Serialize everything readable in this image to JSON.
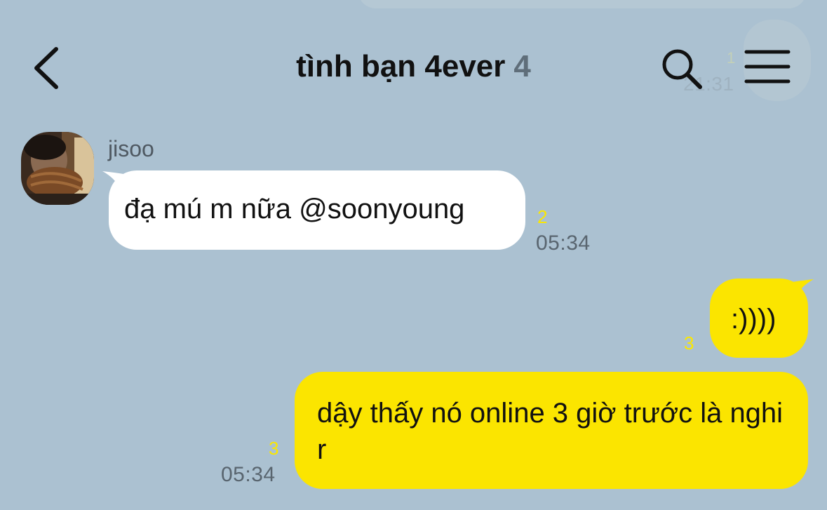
{
  "header": {
    "title": "tình bạn 4ever",
    "member_count": "4",
    "back_icon": "chevron-left-icon",
    "search_icon": "search-icon",
    "menu_icon": "hamburger-menu-icon"
  },
  "background_ghost": {
    "time": "21:31",
    "count": "1"
  },
  "messages": [
    {
      "sender": "jisoo",
      "text": "đạ mú m nữa @soonyoung",
      "unread": "2",
      "time": "05:34"
    },
    {
      "text": ":))))",
      "unread": "3"
    },
    {
      "text": "dậy thấy nó online 3 giờ trước là nghi r",
      "unread": "3",
      "time": "05:34"
    }
  ],
  "colors": {
    "background": "#abc1d1",
    "outgoing_bubble": "#fbe500",
    "incoming_bubble": "#ffffff",
    "unread_count": "#fbe700"
  }
}
